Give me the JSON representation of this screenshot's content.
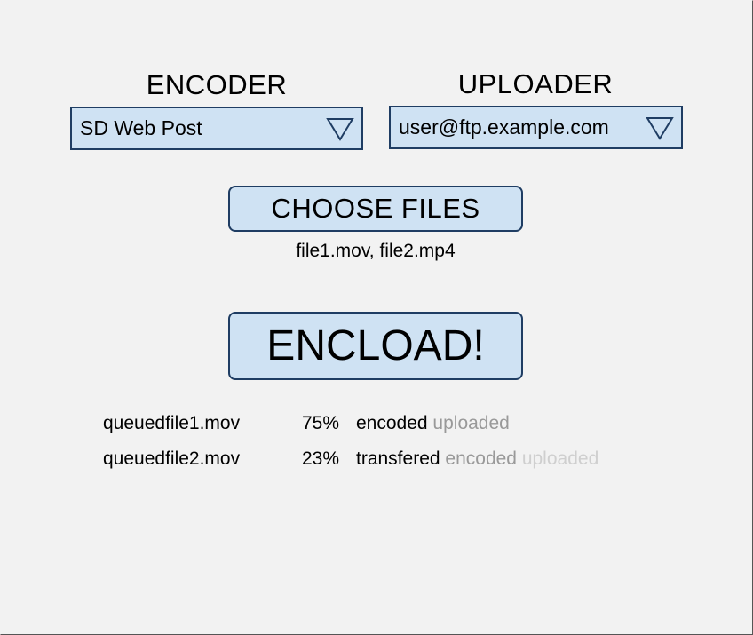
{
  "encoder": {
    "label": "ENCODER",
    "selected": "SD Web Post",
    "arrow_icon": "triangle-down-icon"
  },
  "uploader": {
    "label": "UPLOADER",
    "selected": "user@ftp.example.com",
    "arrow_icon": "triangle-down-icon"
  },
  "choose_files": {
    "label": "CHOOSE FILES",
    "selected_files": "file1.mov, file2.mp4"
  },
  "encload": {
    "label": "ENCLOAD!"
  },
  "queue": [
    {
      "name": "queuedfile1.mov",
      "percent": "75%",
      "states": [
        {
          "label": "encoded",
          "status": "done"
        },
        {
          "label": "uploaded",
          "status": "active"
        }
      ]
    },
    {
      "name": "queuedfile2.mov",
      "percent": "23%",
      "states": [
        {
          "label": "transfered",
          "status": "done"
        },
        {
          "label": "encoded",
          "status": "active"
        },
        {
          "label": "uploaded",
          "status": "pending"
        }
      ]
    }
  ],
  "colors": {
    "background": "#f2f2f2",
    "control_fill": "#cfe2f3",
    "control_border": "#1f3d63",
    "state_done": "#000000",
    "state_active": "#999999",
    "state_pending": "#cfcfcf"
  }
}
